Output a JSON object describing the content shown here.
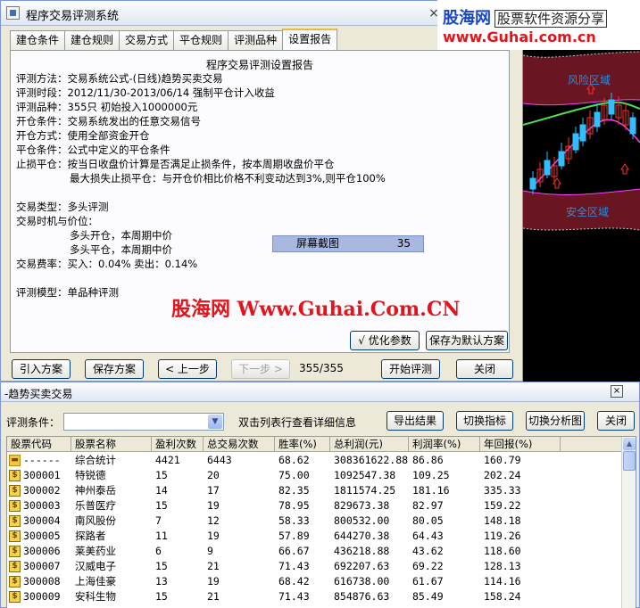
{
  "window": {
    "title": "程序交易评测系统",
    "close_glyph": "×"
  },
  "tabs": [
    "建仓条件",
    "建仓规则",
    "交易方式",
    "平仓规则",
    "评测品种",
    "设置报告"
  ],
  "report": {
    "title": "程序交易评测设置报告",
    "lines": [
      "评测方法：交易系统公式-(日线)趋势买卖交易",
      "评测时段：2012/11/30-2013/06/14 强制平仓计入收益",
      "评测品种：355只 初始投入1000000元",
      "开仓条件：交易系统发出的任意交易信号",
      "开仓方式：使用全部资金开仓",
      "平仓条件：公式中定义的平仓条件",
      "止损平仓：按当日收盘价计算是否满足止损条件，按本周期收盘价平仓",
      "最大损失止损平仓：与开仓价相比价格不利变动达到3%,则平仓100%",
      "",
      "交易类型：多头评测",
      "交易时机与价位：",
      "多头开仓，本周期中价",
      "多头平仓，本周期中价",
      "交易费率：买入：0.04%    卖出：0.14%",
      "",
      "评测模型：单品种评测"
    ],
    "indent_rows": [
      7,
      11,
      12
    ]
  },
  "screenshot_banner": {
    "label": "屏幕截图",
    "value": "35"
  },
  "watermark": {
    "center": "股海网 Www.Guhai.Com.CN",
    "corner_line1": "股海网",
    "corner_sub": "股票软件资源分享",
    "corner_line2": "www.Guhai.com.cn"
  },
  "buttons": {
    "optimize": "√ 优化参数",
    "save_default": "保存为默认方案",
    "import": "引入方案",
    "save": "保存方案",
    "prev": "< 上一步",
    "next": "下一步 >",
    "counter": "355/355",
    "start": "开始评测",
    "close": "关闭"
  },
  "chart": {
    "danger_label": "风险区域",
    "safe_label": "安全区域",
    "colors": {
      "danger_band": "#6a1622",
      "safe_band": "#6a1622",
      "up": "#ff3030",
      "down": "#30c0ff",
      "mid_line": "#50e050",
      "upper_line": "#d0d0d0",
      "lower_line": "#ff40ff"
    }
  },
  "results": {
    "title": "-趋势买卖交易",
    "criteria_label": "评测条件：",
    "criteria_value": "",
    "hint": "双击列表行查看详细信息",
    "export": "导出结果",
    "switch_metric": "切换指标",
    "switch_chart": "切换分析图",
    "close": "关闭",
    "columns": [
      "股票代码",
      "股票名称",
      "盈利次数",
      "总交易次数",
      "胜率(%)",
      "总利润(元)",
      "利润率(%)",
      "年回报(%)"
    ],
    "rows": [
      {
        "code": "------",
        "name": "综合统计",
        "wins": "4421",
        "trades": "6443",
        "winrate": "68.62",
        "profit": "308361622.88",
        "rate": "86.86",
        "annual": "160.79",
        "icon": "folder"
      },
      {
        "code": "300001",
        "name": "特锐德",
        "wins": "15",
        "trades": "20",
        "winrate": "75.00",
        "profit": "1092547.38",
        "rate": "109.25",
        "annual": "202.24",
        "icon": "stock"
      },
      {
        "code": "300002",
        "name": "神州泰岳",
        "wins": "14",
        "trades": "17",
        "winrate": "82.35",
        "profit": "1811574.25",
        "rate": "181.16",
        "annual": "335.33",
        "icon": "stock"
      },
      {
        "code": "300003",
        "name": "乐普医疗",
        "wins": "15",
        "trades": "19",
        "winrate": "78.95",
        "profit": "829673.38",
        "rate": "82.97",
        "annual": "159.22",
        "icon": "stock"
      },
      {
        "code": "300004",
        "name": "南风股份",
        "wins": "7",
        "trades": "12",
        "winrate": "58.33",
        "profit": "800532.00",
        "rate": "80.05",
        "annual": "148.18",
        "icon": "stock"
      },
      {
        "code": "300005",
        "name": "探路者",
        "wins": "11",
        "trades": "19",
        "winrate": "57.89",
        "profit": "644270.38",
        "rate": "64.43",
        "annual": "119.26",
        "icon": "stock"
      },
      {
        "code": "300006",
        "name": "莱美药业",
        "wins": "6",
        "trades": "9",
        "winrate": "66.67",
        "profit": "436218.88",
        "rate": "43.62",
        "annual": "118.60",
        "icon": "stock"
      },
      {
        "code": "300007",
        "name": "汉威电子",
        "wins": "15",
        "trades": "21",
        "winrate": "71.43",
        "profit": "692207.63",
        "rate": "69.22",
        "annual": "128.13",
        "icon": "stock"
      },
      {
        "code": "300008",
        "name": "上海佳豪",
        "wins": "13",
        "trades": "19",
        "winrate": "68.42",
        "profit": "616738.00",
        "rate": "61.67",
        "annual": "114.16",
        "icon": "stock"
      },
      {
        "code": "300009",
        "name": "安科生物",
        "wins": "15",
        "trades": "21",
        "winrate": "71.43",
        "profit": "854876.63",
        "rate": "85.49",
        "annual": "158.24",
        "icon": "stock"
      }
    ],
    "icon_glyphs": {
      "stock": "$",
      "folder": "▬"
    }
  }
}
